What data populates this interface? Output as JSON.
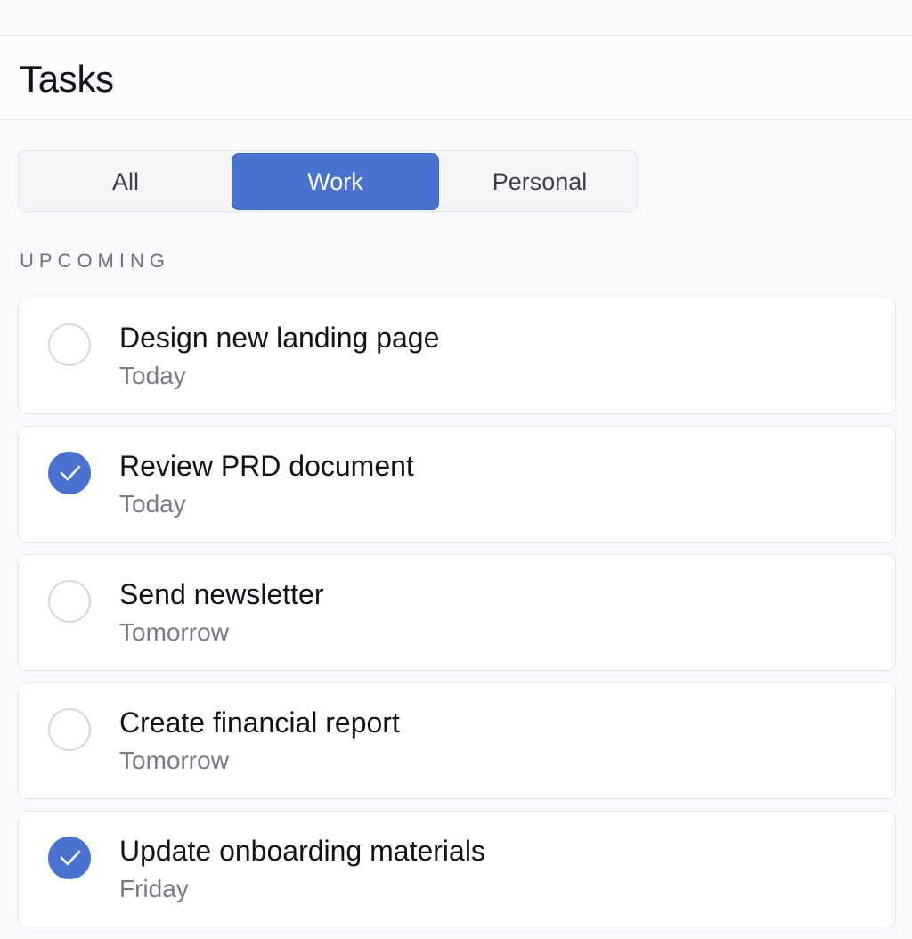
{
  "header": {
    "title": "Tasks"
  },
  "filters": {
    "options": [
      {
        "label": "All",
        "selected": false
      },
      {
        "label": "Work",
        "selected": true
      },
      {
        "label": "Personal",
        "selected": false
      }
    ]
  },
  "section": {
    "label": "UPCOMING"
  },
  "tasks": [
    {
      "title": "Design new landing page",
      "due": "Today",
      "completed": false
    },
    {
      "title": "Review PRD document",
      "due": "Today",
      "completed": true
    },
    {
      "title": "Send newsletter",
      "due": "Tomorrow",
      "completed": false
    },
    {
      "title": "Create financial report",
      "due": "Tomorrow",
      "completed": false
    },
    {
      "title": "Update onboarding materials",
      "due": "Friday",
      "completed": true
    }
  ],
  "colors": {
    "accent": "#4a72d0",
    "background": "#f8f9fb",
    "card": "#ffffff",
    "muted_text": "#757b87"
  },
  "icons": {
    "checkmark": "checkmark-icon"
  }
}
